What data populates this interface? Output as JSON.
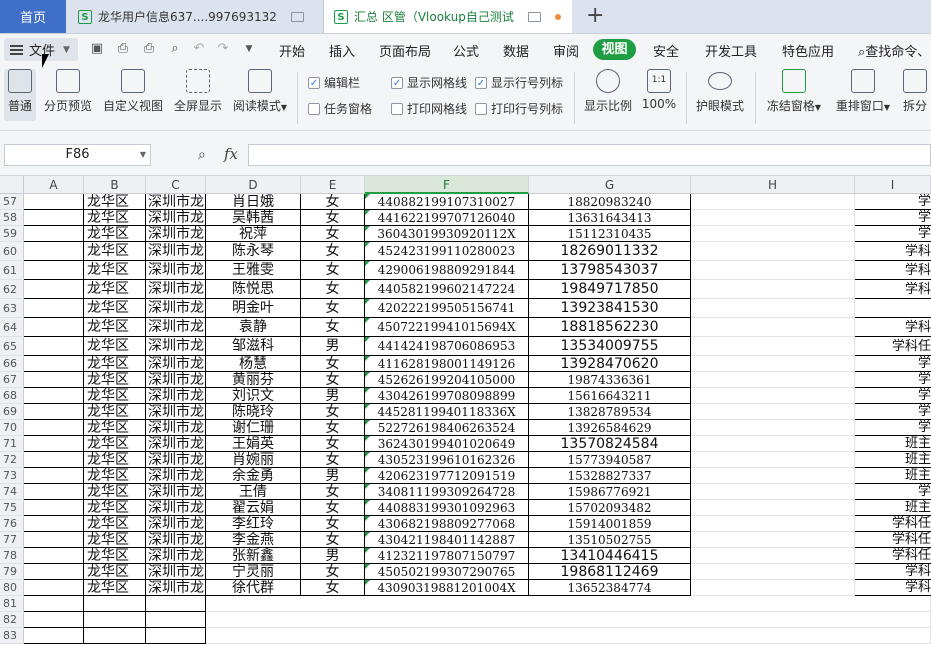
{
  "tabs": {
    "home": "首页",
    "doc1": "龙华用户信息637....997693132",
    "doc2": "汇总 区管（Vlookup自己测试"
  },
  "menu": {
    "file": "文件",
    "items": [
      "开始",
      "插入",
      "页面布局",
      "公式",
      "数据",
      "审阅",
      "视图",
      "安全",
      "开发工具",
      "特色应用"
    ],
    "active": "视图",
    "search": "查找命令、"
  },
  "ribbon": {
    "normal": "普通",
    "page_preview": "分页预览",
    "custom_view": "自定义视图",
    "full_screen": "全屏显示",
    "reading_mode": "阅读模式",
    "edit_bar": "编辑栏",
    "task_pane": "任务窗格",
    "show_grid": "显示网格线",
    "print_grid": "打印网格线",
    "show_rowcol": "显示行号列标",
    "print_rowcol": "打印行号列标",
    "zoom": "显示比例",
    "zoom100": "100%",
    "eye_mode": "护眼模式",
    "freeze": "冻结窗格",
    "rearrange": "重排窗口",
    "split": "拆分"
  },
  "formula": {
    "cell_ref": "F86",
    "fx": "fx",
    "value": ""
  },
  "columns": [
    "A",
    "B",
    "C",
    "D",
    "E",
    "F",
    "G",
    "H",
    "I"
  ],
  "rows": [
    {
      "n": "57",
      "b": "龙华区",
      "c": "深圳市龙",
      "d": "肖日娥",
      "e": "女",
      "f": "440882199107310027",
      "g": "18820983240",
      "i": "学"
    },
    {
      "n": "58",
      "b": "龙华区",
      "c": "深圳市龙",
      "d": "吴韩茜",
      "e": "女",
      "f": "441622199707126040",
      "g": "13631643413",
      "i": "学"
    },
    {
      "n": "59",
      "b": "龙华区",
      "c": "深圳市龙",
      "d": "祝萍",
      "e": "女",
      "f": "36043019930920112X",
      "g": "15112310435",
      "i": "学"
    },
    {
      "n": "60",
      "b": "龙华区",
      "c": "深圳市龙",
      "d": "陈永琴",
      "e": "女",
      "f": "452423199110280023",
      "g": "18269011332",
      "i": "学科"
    },
    {
      "n": "61",
      "b": "龙华区",
      "c": "深圳市龙",
      "d": "王雅雯",
      "e": "女",
      "f": "429006198809291844",
      "g": "13798543037",
      "i": "学科"
    },
    {
      "n": "62",
      "b": "龙华区",
      "c": "深圳市龙",
      "d": "陈悦思",
      "e": "女",
      "f": "440582199602147224",
      "g": "19849717850",
      "i": "学科"
    },
    {
      "n": "63",
      "b": "龙华区",
      "c": "深圳市龙",
      "d": "明金叶",
      "e": "女",
      "f": "420222199505156741",
      "g": "13923841530",
      "i": ""
    },
    {
      "n": "64",
      "b": "龙华区",
      "c": "深圳市龙",
      "d": "袁静",
      "e": "女",
      "f": "45072219941015694X",
      "g": "18818562230",
      "i": "学科"
    },
    {
      "n": "65",
      "b": "龙华区",
      "c": "深圳市龙",
      "d": "邹滋科",
      "e": "男",
      "f": "441424198706086953",
      "g": "13534009755",
      "i": "学科任"
    },
    {
      "n": "66",
      "b": "龙华区",
      "c": "深圳市龙",
      "d": "杨慧",
      "e": "女",
      "f": "411628198001149126",
      "g": "13928470620",
      "i": "学"
    },
    {
      "n": "67",
      "b": "龙华区",
      "c": "深圳市龙",
      "d": "黄丽芬",
      "e": "女",
      "f": "452626199204105000",
      "g": "19874336361",
      "i": "学"
    },
    {
      "n": "68",
      "b": "龙华区",
      "c": "深圳市龙",
      "d": "刘识文",
      "e": "男",
      "f": "430426199708098899",
      "g": "15616643211",
      "i": "学"
    },
    {
      "n": "69",
      "b": "龙华区",
      "c": "深圳市龙",
      "d": "陈晓玲",
      "e": "女",
      "f": "44528119940118336X",
      "g": "13828789534",
      "i": "学"
    },
    {
      "n": "70",
      "b": "龙华区",
      "c": "深圳市龙",
      "d": "谢仁珊",
      "e": "女",
      "f": "522726198406263524",
      "g": "13926584629",
      "i": "学"
    },
    {
      "n": "71",
      "b": "龙华区",
      "c": "深圳市龙",
      "d": "王娟英",
      "e": "女",
      "f": "362430199401020649",
      "g": "13570824584",
      "i": "班主"
    },
    {
      "n": "72",
      "b": "龙华区",
      "c": "深圳市龙",
      "d": "肖婉丽",
      "e": "女",
      "f": "430523199610162326",
      "g": "15773940587",
      "i": "班主"
    },
    {
      "n": "73",
      "b": "龙华区",
      "c": "深圳市龙",
      "d": "余金勇",
      "e": "男",
      "f": "420623197712091519",
      "g": "15328827337",
      "i": "班主"
    },
    {
      "n": "74",
      "b": "龙华区",
      "c": "深圳市龙",
      "d": "王倩",
      "e": "女",
      "f": "340811199309264728",
      "g": "15986776921",
      "i": "学"
    },
    {
      "n": "75",
      "b": "龙华区",
      "c": "深圳市龙",
      "d": "翟云娟",
      "e": "女",
      "f": "440883199301092963",
      "g": "15702093482",
      "i": "班主"
    },
    {
      "n": "76",
      "b": "龙华区",
      "c": "深圳市龙",
      "d": "李红玲",
      "e": "女",
      "f": "430682198809277068",
      "g": "15914001859",
      "i": "学科任"
    },
    {
      "n": "77",
      "b": "龙华区",
      "c": "深圳市龙",
      "d": "李金燕",
      "e": "女",
      "f": "430421198401142887",
      "g": "13510502755",
      "i": "学科任"
    },
    {
      "n": "78",
      "b": "龙华区",
      "c": "深圳市龙",
      "d": "张新鑫",
      "e": "男",
      "f": "412321197807150797",
      "g": "13410446415",
      "i": "学科任"
    },
    {
      "n": "79",
      "b": "龙华区",
      "c": "深圳市龙",
      "d": "宁灵丽",
      "e": "女",
      "f": "450502199307290765",
      "g": "19868112469",
      "i": "学科"
    },
    {
      "n": "80",
      "b": "龙华区",
      "c": "深圳市龙",
      "d": "徐代群",
      "e": "女",
      "f": "43090319881201004X",
      "g": "13652384774",
      "i": "学科"
    },
    {
      "n": "81",
      "b": "",
      "c": "",
      "d": "",
      "e": "",
      "f": "",
      "g": "",
      "i": ""
    },
    {
      "n": "82",
      "b": "",
      "c": "",
      "d": "",
      "e": "",
      "f": "",
      "g": "",
      "i": ""
    },
    {
      "n": "83",
      "b": "",
      "c": "",
      "d": "",
      "e": "",
      "f": "",
      "g": "",
      "i": ""
    }
  ]
}
